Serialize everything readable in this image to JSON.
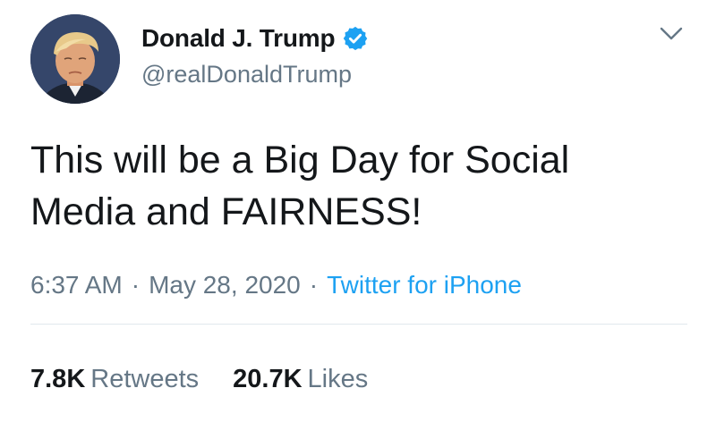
{
  "user": {
    "display_name": "Donald J. Trump",
    "handle": "@realDonaldTrump",
    "verified": true,
    "avatar_icon": "profile-photo"
  },
  "tweet": {
    "text": "This will be a Big Day for Social Media and FAIRNESS!",
    "time": "6:37 AM",
    "date": "May 28, 2020",
    "separator": "·",
    "source": "Twitter for iPhone"
  },
  "stats": {
    "retweets_count": "7.8K",
    "retweets_label": "Retweets",
    "likes_count": "20.7K",
    "likes_label": "Likes"
  },
  "icons": {
    "verified": "verified-badge-icon",
    "menu": "chevron-down-icon"
  },
  "colors": {
    "verified_blue": "#1da1f2",
    "link_blue": "#1da1f2",
    "secondary_text": "#657786",
    "primary_text": "#14171a",
    "divider": "#e1e8ed"
  }
}
